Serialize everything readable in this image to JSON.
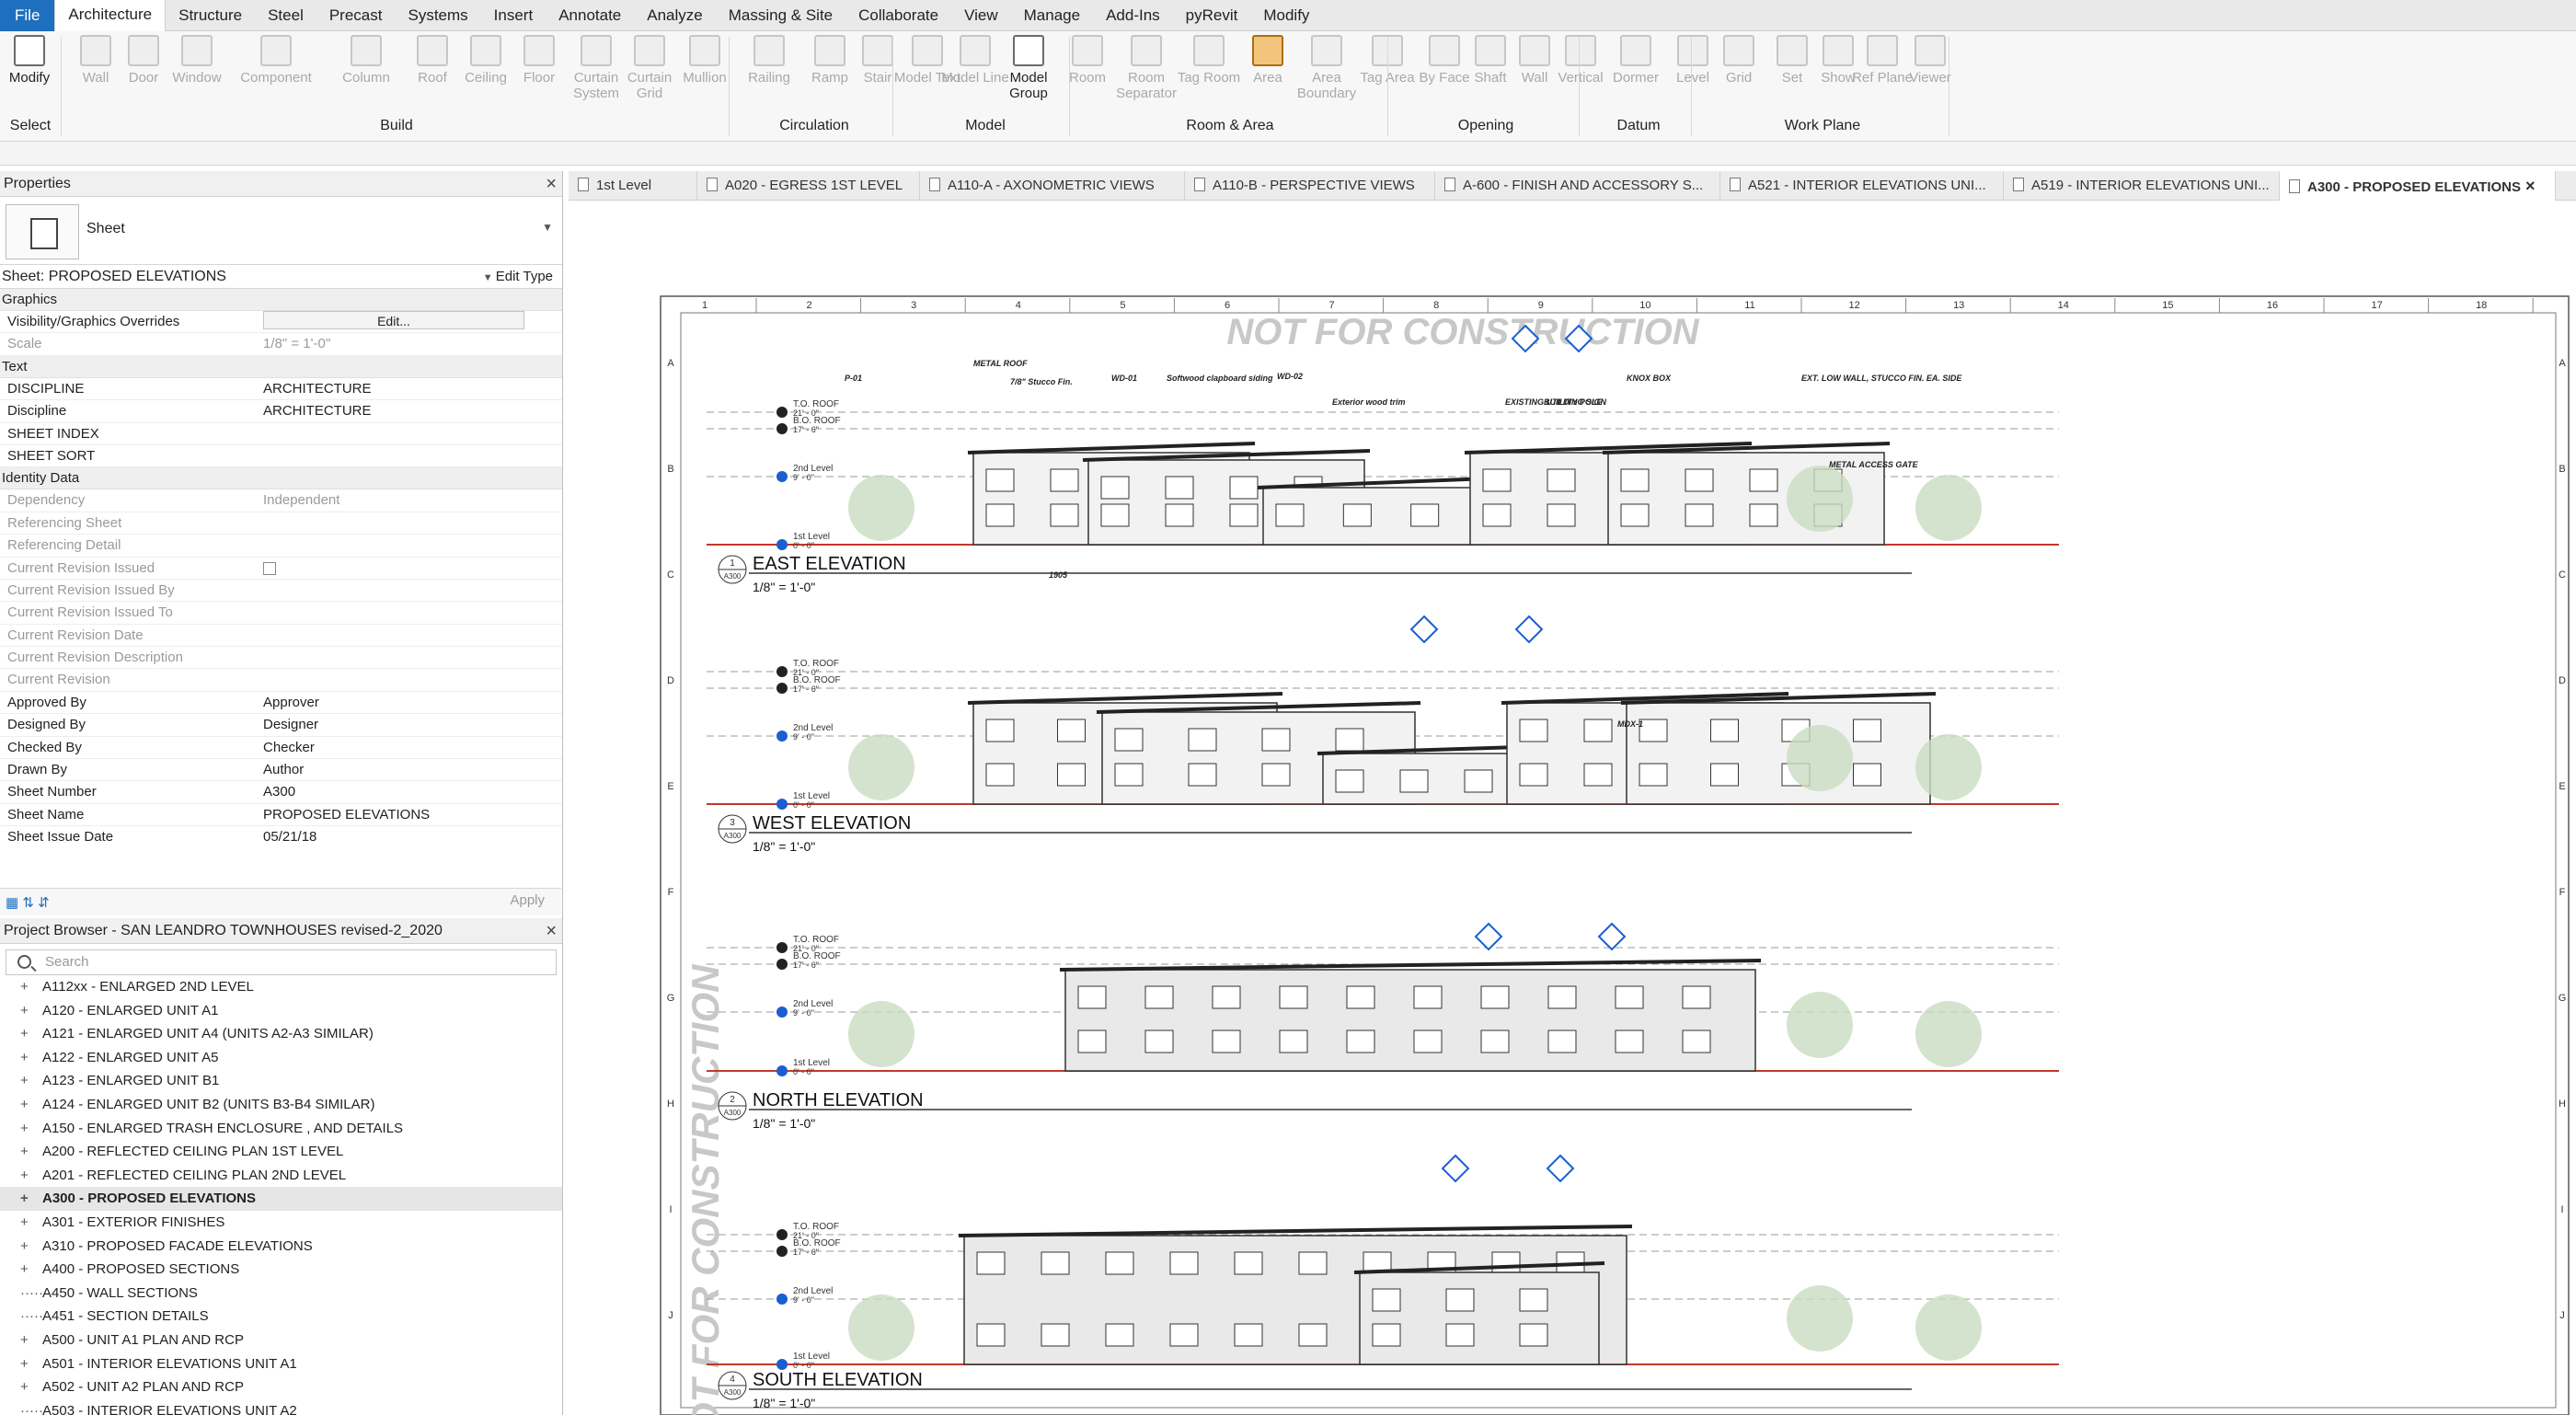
{
  "ribbon": {
    "tabs": [
      "File",
      "Architecture",
      "Structure",
      "Steel",
      "Precast",
      "Systems",
      "Insert",
      "Annotate",
      "Analyze",
      "Massing & Site",
      "Collaborate",
      "View",
      "Manage",
      "Add-Ins",
      "pyRevit",
      "Modify"
    ],
    "active_tab": "Architecture",
    "tools": [
      {
        "label": "Modify",
        "state": "on"
      },
      {
        "label": "Wall"
      },
      {
        "label": "Door"
      },
      {
        "label": "Window"
      },
      {
        "label": "Component"
      },
      {
        "label": "Column"
      },
      {
        "label": "Roof"
      },
      {
        "label": "Ceiling"
      },
      {
        "label": "Floor"
      },
      {
        "label": "Curtain System"
      },
      {
        "label": "Curtain Grid"
      },
      {
        "label": "Mullion"
      },
      {
        "label": "Railing"
      },
      {
        "label": "Ramp"
      },
      {
        "label": "Stair"
      },
      {
        "label": "Model Text"
      },
      {
        "label": "Model Line"
      },
      {
        "label": "Model Group",
        "state": "on"
      },
      {
        "label": "Room"
      },
      {
        "label": "Room Separator"
      },
      {
        "label": "Tag Room"
      },
      {
        "label": "Area",
        "state": "sel"
      },
      {
        "label": "Area Boundary"
      },
      {
        "label": "Tag Area"
      },
      {
        "label": "By Face"
      },
      {
        "label": "Shaft"
      },
      {
        "label": "Wall"
      },
      {
        "label": "Vertical"
      },
      {
        "label": "Dormer"
      },
      {
        "label": "Level"
      },
      {
        "label": "Grid"
      },
      {
        "label": "Set"
      },
      {
        "label": "Show"
      },
      {
        "label": "Ref Plane"
      },
      {
        "label": "Viewer"
      }
    ],
    "groups": [
      "Select",
      "Build",
      "Circulation",
      "Model",
      "Room & Area",
      "Opening",
      "Datum",
      "Work Plane"
    ]
  },
  "properties": {
    "title": "Properties",
    "type_name": "Sheet",
    "selector": "Sheet: PROPOSED ELEVATIONS",
    "edit_type": "Edit Type",
    "apply": "Apply",
    "sections": [
      {
        "name": "Graphics",
        "rows": [
          {
            "key": "Visibility/Graphics Overrides",
            "value": "Edit...",
            "kind": "button"
          },
          {
            "key": "Scale",
            "value": "1/8\" = 1'-0\"",
            "dim": true
          }
        ]
      },
      {
        "name": "Text",
        "rows": [
          {
            "key": "DISCIPLINE",
            "value": "ARCHITECTURE"
          },
          {
            "key": "Discipline",
            "value": "ARCHITECTURE"
          },
          {
            "key": "SHEET INDEX",
            "value": ""
          },
          {
            "key": "SHEET SORT",
            "value": ""
          }
        ]
      },
      {
        "name": "Identity Data",
        "rows": [
          {
            "key": "Dependency",
            "value": "Independent",
            "dim": true
          },
          {
            "key": "Referencing Sheet",
            "value": "",
            "dim": true
          },
          {
            "key": "Referencing Detail",
            "value": "",
            "dim": true
          },
          {
            "key": "Current Revision Issued",
            "value": "",
            "kind": "checkbox",
            "dim": true
          },
          {
            "key": "Current Revision Issued By",
            "value": "",
            "dim": true
          },
          {
            "key": "Current Revision Issued To",
            "value": "",
            "dim": true
          },
          {
            "key": "Current Revision Date",
            "value": "",
            "dim": true
          },
          {
            "key": "Current Revision Description",
            "value": "",
            "dim": true
          },
          {
            "key": "Current Revision",
            "value": "",
            "dim": true
          },
          {
            "key": "Approved By",
            "value": "Approver"
          },
          {
            "key": "Designed By",
            "value": "Designer"
          },
          {
            "key": "Checked By",
            "value": "Checker"
          },
          {
            "key": "Drawn By",
            "value": "Author"
          },
          {
            "key": "Sheet Number",
            "value": "A300"
          },
          {
            "key": "Sheet Name",
            "value": "PROPOSED ELEVATIONS"
          },
          {
            "key": "Sheet Issue Date",
            "value": "05/21/18"
          },
          {
            "key": "Appears In Sheet List",
            "value": "✔",
            "kind": "checkbox"
          }
        ]
      }
    ]
  },
  "browser": {
    "title": "Project Browser - SAN LEANDRO TOWNHOUSES revised-2_2020",
    "search_placeholder": "Search",
    "items": [
      {
        "label": "A112xx - ENLARGED 2ND LEVEL",
        "exp": true
      },
      {
        "label": "A120 - ENLARGED UNIT A1",
        "exp": true
      },
      {
        "label": "A121 - ENLARGED UNIT A4 (UNITS A2-A3 SIMILAR)",
        "exp": true
      },
      {
        "label": "A122 - ENLARGED UNIT A5",
        "exp": true
      },
      {
        "label": "A123 - ENLARGED UNIT B1",
        "exp": true
      },
      {
        "label": "A124 - ENLARGED UNIT B2 (UNITS B3-B4 SIMILAR)",
        "exp": true
      },
      {
        "label": "A150 - ENLARGED TRASH ENCLOSURE , AND DETAILS",
        "exp": true
      },
      {
        "label": "A200 - REFLECTED CEILING PLAN 1ST LEVEL",
        "exp": true
      },
      {
        "label": "A201 - REFLECTED CEILING PLAN 2ND LEVEL",
        "exp": true
      },
      {
        "label": "A300 - PROPOSED ELEVATIONS",
        "exp": true,
        "sel": true
      },
      {
        "label": "A301 - EXTERIOR FINISHES",
        "exp": true
      },
      {
        "label": "A310 - PROPOSED FACADE ELEVATIONS",
        "exp": true
      },
      {
        "label": "A400 - PROPOSED SECTIONS",
        "exp": true
      },
      {
        "label": "A450 - WALL SECTIONS",
        "exp": false
      },
      {
        "label": "A451 - SECTION DETAILS",
        "exp": false
      },
      {
        "label": "A500 - UNIT A1 PLAN AND RCP",
        "exp": true
      },
      {
        "label": "A501 - INTERIOR ELEVATIONS UNIT A1",
        "exp": true
      },
      {
        "label": "A502 - UNIT A2 PLAN AND RCP",
        "exp": true
      },
      {
        "label": "A503 - INTERIOR ELEVATIONS UNIT A2",
        "exp": false
      }
    ]
  },
  "view_tabs": [
    {
      "label": "1st Level"
    },
    {
      "label": "A020 - EGRESS 1ST LEVEL"
    },
    {
      "label": "A110-A - AXONOMETRIC VIEWS"
    },
    {
      "label": "A110-B - PERSPECTIVE VIEWS"
    },
    {
      "label": "A-600 - FINISH AND ACCESSORY S..."
    },
    {
      "label": "A521 - INTERIOR ELEVATIONS UNI..."
    },
    {
      "label": "A519 - INTERIOR ELEVATIONS UNI..."
    },
    {
      "label": "A300 - PROPOSED ELEVATIONS",
      "active": true
    }
  ],
  "sheet": {
    "watermark_top": "NOT FOR CONSTRUCTION",
    "watermark_side": "NOT FOR CONSTRUCTION",
    "grid_cols": [
      "1",
      "2",
      "3",
      "4",
      "5",
      "6",
      "7",
      "8",
      "9",
      "10",
      "11",
      "12",
      "13",
      "14",
      "15",
      "16",
      "17",
      "18"
    ],
    "grid_rows": [
      "A",
      "B",
      "C",
      "D",
      "E",
      "F",
      "G",
      "H",
      "I",
      "J"
    ],
    "elevations": [
      {
        "num": "1",
        "sheet": "A300",
        "title": "EAST ELEVATION",
        "scale": "1/8\" = 1'-0\""
      },
      {
        "num": "3",
        "sheet": "A300",
        "title": "WEST ELEVATION",
        "scale": "1/8\" = 1'-0\""
      },
      {
        "num": "2",
        "sheet": "A300",
        "title": "NORTH ELEVATION",
        "scale": "1/8\" = 1'-0\""
      },
      {
        "num": "4",
        "sheet": "A300",
        "title": "SOUTH ELEVATION",
        "scale": "1/8\" = 1'-0\""
      }
    ],
    "levels": [
      {
        "name": "T.O. ROOF",
        "elev": "21' - 0\""
      },
      {
        "name": "B.O. ROOF",
        "elev": "17' - 6\""
      },
      {
        "name": "2nd Level",
        "elev": "9' - 0\""
      },
      {
        "name": "1st Level",
        "elev": "0' - 0\""
      }
    ],
    "notes": [
      "METAL ROOF",
      "P-01",
      "7/8\" Stucco Fin.",
      "WD-01",
      "Softwood clapboard siding",
      "WD-02",
      "Exterior wood trim",
      "EXISTING UTILITY POLE",
      "BUILDING SIGN",
      "KNOX BOX",
      "EXT. LOW WALL, STUCCO FIN. EA. SIDE",
      "METAL ACCESS GATE",
      "1905",
      "MDX-1"
    ]
  },
  "colors": {
    "accent": "#1f6fbf",
    "tag_blue": "#1a5fd0",
    "level_red": "#c0392b"
  }
}
